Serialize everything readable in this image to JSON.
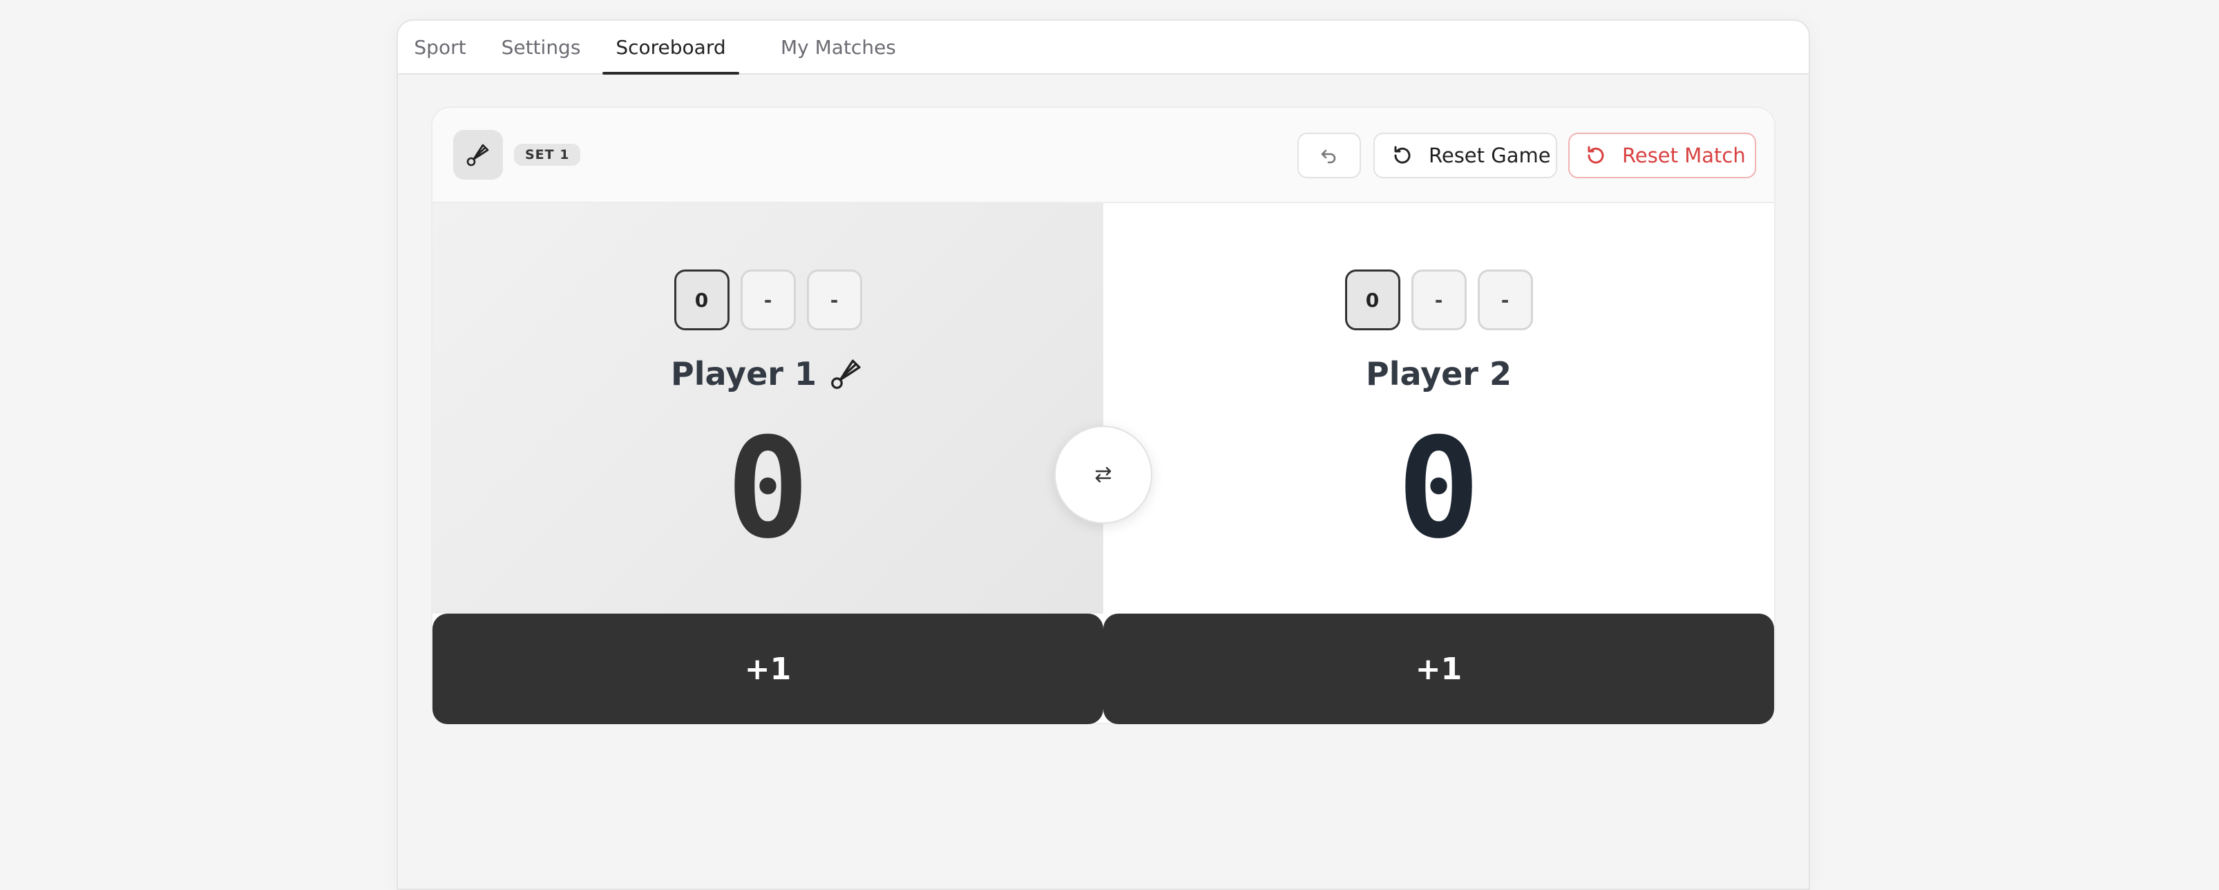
{
  "tabs": [
    {
      "label": "Sport"
    },
    {
      "label": "Settings"
    },
    {
      "label": "Scoreboard",
      "active": true
    },
    {
      "label": "My Matches"
    }
  ],
  "toolbar": {
    "sport_icon": "badminton-shuttlecock-icon",
    "set_badge": "SET 1",
    "undo_icon": "undo-icon",
    "reset_game_label": "Reset Game",
    "reset_match_label": "Reset Match"
  },
  "players": [
    {
      "name": "Player 1",
      "serving": true,
      "sets": [
        "0",
        "-",
        "-"
      ],
      "score": "0",
      "plus_label": "+1"
    },
    {
      "name": "Player 2",
      "serving": false,
      "sets": [
        "0",
        "-",
        "-"
      ],
      "score": "0",
      "plus_label": "+1"
    }
  ],
  "swap_icon": "swap-arrows-icon",
  "colors": {
    "accent_dark": "#333333",
    "danger": "#d94040",
    "danger_border": "#f0b3b3"
  }
}
